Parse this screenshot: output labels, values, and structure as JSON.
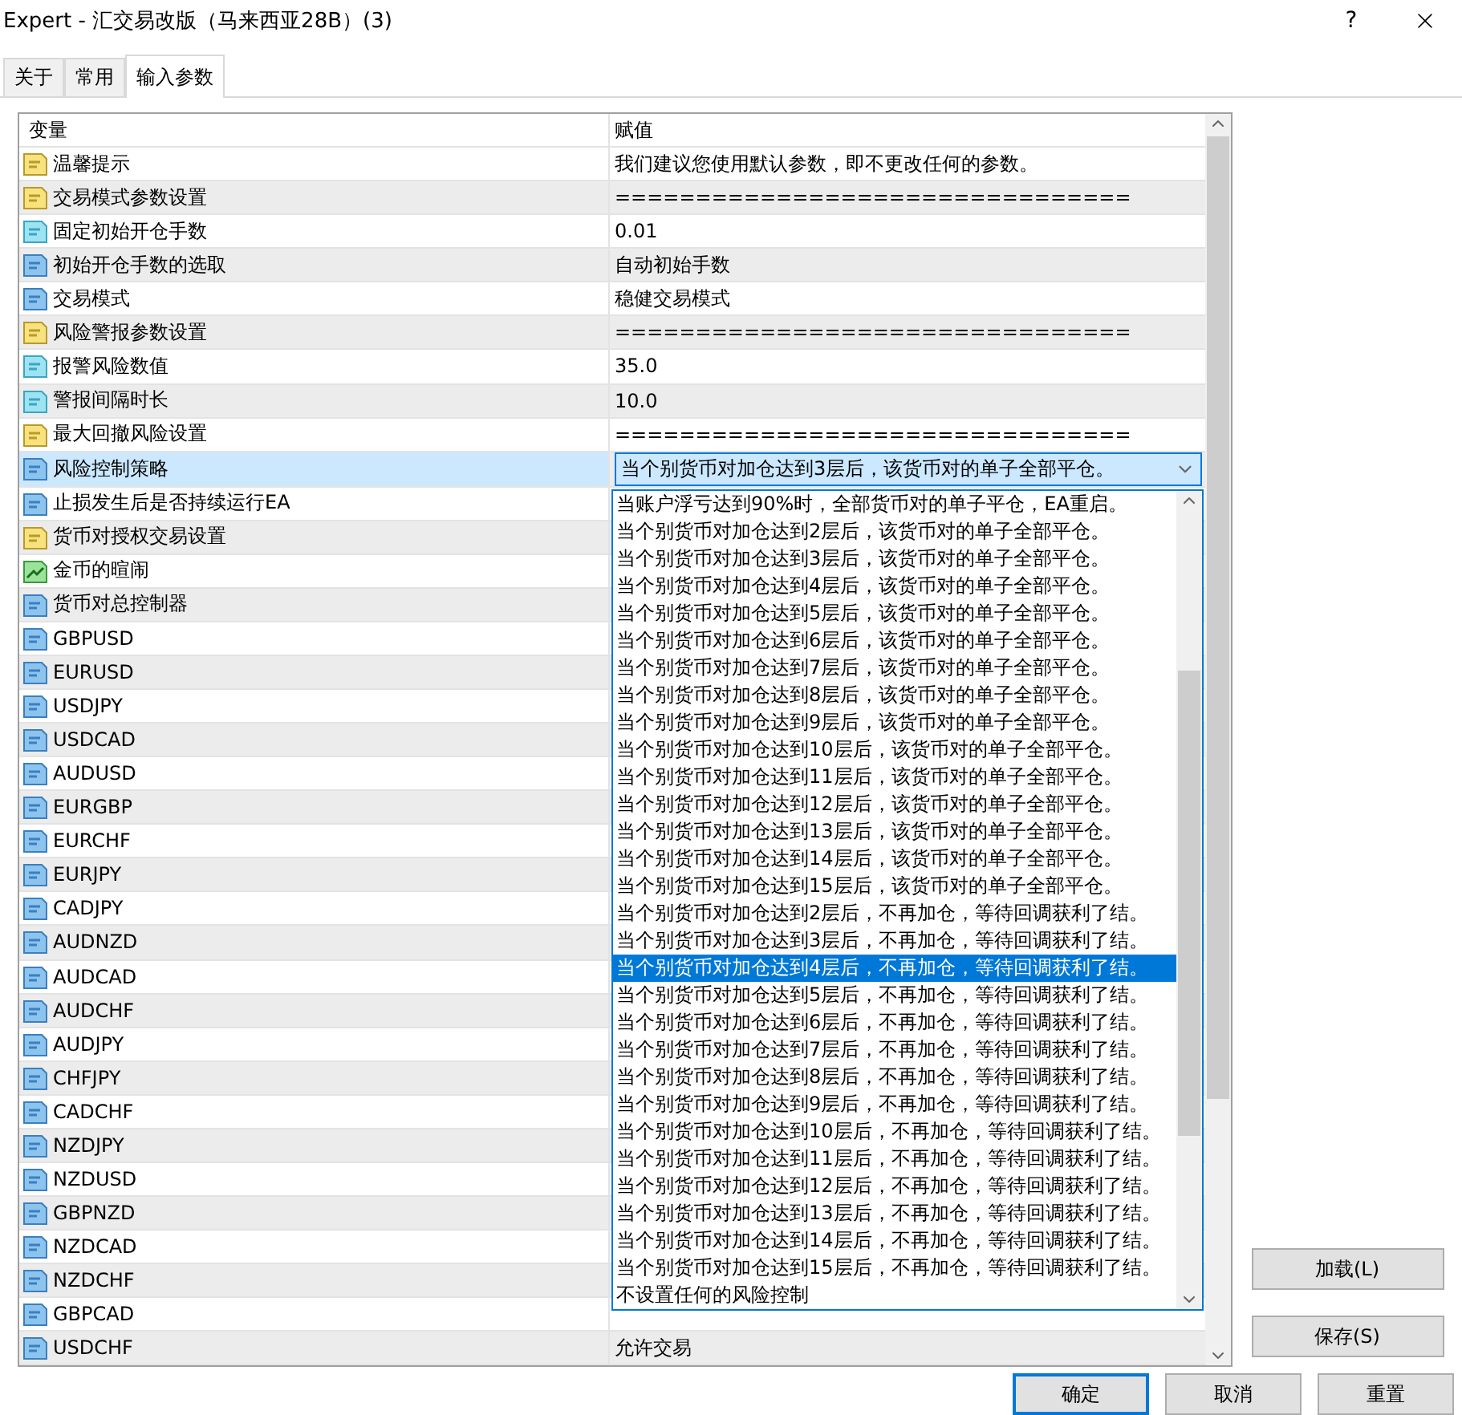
{
  "window": {
    "title": "Expert - 汇交易改版（马来西亚28B）(3)",
    "help": "?"
  },
  "tabs": [
    {
      "label": "关于",
      "selected": false
    },
    {
      "label": "常用",
      "selected": false
    },
    {
      "label": "输入参数",
      "selected": true
    }
  ],
  "table": {
    "columns": [
      "变量",
      "赋值"
    ],
    "rows": [
      {
        "name": "温馨提示",
        "kind": "text",
        "value": "我们建议您使用默认参数，即不更改任何的参数。",
        "selected": false
      },
      {
        "name": "交易模式参数设置",
        "kind": "text",
        "value": "================================",
        "selected": false
      },
      {
        "name": "固定初始开仓手数",
        "kind": "double",
        "value": "0.01",
        "selected": false
      },
      {
        "name": "初始开仓手数的选取",
        "kind": "integer",
        "value": "自动初始手数",
        "selected": false
      },
      {
        "name": "交易模式",
        "kind": "integer",
        "value": "稳健交易模式",
        "selected": false
      },
      {
        "name": "风险警报参数设置",
        "kind": "text",
        "value": "================================",
        "selected": false
      },
      {
        "name": "报警风险数值",
        "kind": "double",
        "value": "35.0",
        "selected": false
      },
      {
        "name": "警报间隔时长",
        "kind": "double",
        "value": "10.0",
        "selected": false
      },
      {
        "name": "最大回撤风险设置",
        "kind": "text",
        "value": "================================",
        "selected": false
      },
      {
        "name": "风险控制策略",
        "kind": "integer",
        "value": "当个别货币对加仓达到3层后，该货币对的单子全部平仓。",
        "selected": true
      },
      {
        "name": "止损发生后是否持续运行EA",
        "kind": "integer",
        "selected": false
      },
      {
        "name": "货币对授权交易设置",
        "kind": "text",
        "selected": false
      },
      {
        "name": "金币的暄闹",
        "kind": "color",
        "selected": false
      },
      {
        "name": "货币对总控制器",
        "kind": "integer",
        "selected": false
      },
      {
        "name": "GBPUSD",
        "kind": "integer",
        "selected": false
      },
      {
        "name": "EURUSD",
        "kind": "integer",
        "selected": false
      },
      {
        "name": "USDJPY",
        "kind": "integer",
        "selected": false
      },
      {
        "name": "USDCAD",
        "kind": "integer",
        "selected": false
      },
      {
        "name": "AUDUSD",
        "kind": "integer",
        "selected": false
      },
      {
        "name": "EURGBP",
        "kind": "integer",
        "selected": false
      },
      {
        "name": "EURCHF",
        "kind": "integer",
        "selected": false
      },
      {
        "name": "EURJPY",
        "kind": "integer",
        "selected": false
      },
      {
        "name": "CADJPY",
        "kind": "integer",
        "selected": false
      },
      {
        "name": "AUDNZD",
        "kind": "integer",
        "selected": false
      },
      {
        "name": "AUDCAD",
        "kind": "integer",
        "selected": false
      },
      {
        "name": "AUDCHF",
        "kind": "integer",
        "selected": false
      },
      {
        "name": "AUDJPY",
        "kind": "integer",
        "selected": false
      },
      {
        "name": "CHFJPY",
        "kind": "integer",
        "selected": false
      },
      {
        "name": "CADCHF",
        "kind": "integer",
        "selected": false
      },
      {
        "name": "NZDJPY",
        "kind": "integer",
        "selected": false
      },
      {
        "name": "NZDUSD",
        "kind": "integer",
        "selected": false
      },
      {
        "name": "GBPNZD",
        "kind": "integer",
        "selected": false
      },
      {
        "name": "NZDCAD",
        "kind": "integer",
        "selected": false
      },
      {
        "name": "NZDCHF",
        "kind": "integer",
        "selected": false
      },
      {
        "name": "GBPCAD",
        "kind": "integer",
        "selected": false
      },
      {
        "name": "USDCHF",
        "kind": "integer",
        "value": "允许交易",
        "selected": false
      }
    ]
  },
  "dropdown_list": [
    {
      "label": "当账户浮亏达到90%时，全部货币对的单子平仓，EA重启。",
      "selected": false
    },
    {
      "label": "当个别货币对加仓达到2层后，该货币对的单子全部平仓。",
      "selected": false
    },
    {
      "label": "当个别货币对加仓达到3层后，该货币对的单子全部平仓。",
      "selected": false
    },
    {
      "label": "当个别货币对加仓达到4层后，该货币对的单子全部平仓。",
      "selected": false
    },
    {
      "label": "当个别货币对加仓达到5层后，该货币对的单子全部平仓。",
      "selected": false
    },
    {
      "label": "当个别货币对加仓达到6层后，该货币对的单子全部平仓。",
      "selected": false
    },
    {
      "label": "当个别货币对加仓达到7层后，该货币对的单子全部平仓。",
      "selected": false
    },
    {
      "label": "当个别货币对加仓达到8层后，该货币对的单子全部平仓。",
      "selected": false
    },
    {
      "label": "当个别货币对加仓达到9层后，该货币对的单子全部平仓。",
      "selected": false
    },
    {
      "label": "当个别货币对加仓达到10层后，该货币对的单子全部平仓。",
      "selected": false
    },
    {
      "label": "当个别货币对加仓达到11层后，该货币对的单子全部平仓。",
      "selected": false
    },
    {
      "label": "当个别货币对加仓达到12层后，该货币对的单子全部平仓。",
      "selected": false
    },
    {
      "label": "当个别货币对加仓达到13层后，该货币对的单子全部平仓。",
      "selected": false
    },
    {
      "label": "当个别货币对加仓达到14层后，该货币对的单子全部平仓。",
      "selected": false
    },
    {
      "label": "当个别货币对加仓达到15层后，该货币对的单子全部平仓。",
      "selected": false
    },
    {
      "label": "当个别货币对加仓达到2层后，不再加仓，等待回调获利了结。",
      "selected": false
    },
    {
      "label": "当个别货币对加仓达到3层后，不再加仓，等待回调获利了结。",
      "selected": false
    },
    {
      "label": "当个别货币对加仓达到4层后，不再加仓，等待回调获利了结。",
      "selected": true
    },
    {
      "label": "当个别货币对加仓达到5层后，不再加仓，等待回调获利了结。",
      "selected": false
    },
    {
      "label": "当个别货币对加仓达到6层后，不再加仓，等待回调获利了结。",
      "selected": false
    },
    {
      "label": "当个别货币对加仓达到7层后，不再加仓，等待回调获利了结。",
      "selected": false
    },
    {
      "label": "当个别货币对加仓达到8层后，不再加仓，等待回调获利了结。",
      "selected": false
    },
    {
      "label": "当个别货币对加仓达到9层后，不再加仓，等待回调获利了结。",
      "selected": false
    },
    {
      "label": "当个别货币对加仓达到10层后，不再加仓，等待回调获利了结。",
      "selected": false
    },
    {
      "label": "当个别货币对加仓达到11层后，不再加仓，等待回调获利了结。",
      "selected": false
    },
    {
      "label": "当个别货币对加仓达到12层后，不再加仓，等待回调获利了结。",
      "selected": false
    },
    {
      "label": "当个别货币对加仓达到13层后，不再加仓，等待回调获利了结。",
      "selected": false
    },
    {
      "label": "当个别货币对加仓达到14层后，不再加仓，等待回调获利了结。",
      "selected": false
    },
    {
      "label": "当个别货币对加仓达到15层后，不再加仓，等待回调获利了结。",
      "selected": false
    },
    {
      "label": "不设置任何的风险控制",
      "selected": false
    }
  ],
  "side_buttons": [
    "加载(L)",
    "保存(S)"
  ],
  "buttons": [
    {
      "label": "确定",
      "default": true
    },
    {
      "label": "取消",
      "default": false
    },
    {
      "label": "重置",
      "default": false
    }
  ]
}
